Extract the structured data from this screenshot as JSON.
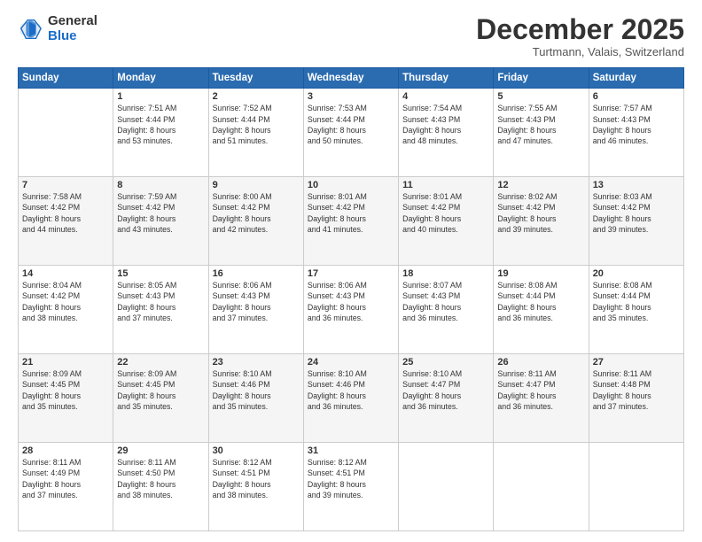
{
  "header": {
    "logo_general": "General",
    "logo_blue": "Blue",
    "month_title": "December 2025",
    "location": "Turtmann, Valais, Switzerland"
  },
  "days_of_week": [
    "Sunday",
    "Monday",
    "Tuesday",
    "Wednesday",
    "Thursday",
    "Friday",
    "Saturday"
  ],
  "weeks": [
    [
      {
        "day": "",
        "info": ""
      },
      {
        "day": "1",
        "info": "Sunrise: 7:51 AM\nSunset: 4:44 PM\nDaylight: 8 hours\nand 53 minutes."
      },
      {
        "day": "2",
        "info": "Sunrise: 7:52 AM\nSunset: 4:44 PM\nDaylight: 8 hours\nand 51 minutes."
      },
      {
        "day": "3",
        "info": "Sunrise: 7:53 AM\nSunset: 4:44 PM\nDaylight: 8 hours\nand 50 minutes."
      },
      {
        "day": "4",
        "info": "Sunrise: 7:54 AM\nSunset: 4:43 PM\nDaylight: 8 hours\nand 48 minutes."
      },
      {
        "day": "5",
        "info": "Sunrise: 7:55 AM\nSunset: 4:43 PM\nDaylight: 8 hours\nand 47 minutes."
      },
      {
        "day": "6",
        "info": "Sunrise: 7:57 AM\nSunset: 4:43 PM\nDaylight: 8 hours\nand 46 minutes."
      }
    ],
    [
      {
        "day": "7",
        "info": "Sunrise: 7:58 AM\nSunset: 4:42 PM\nDaylight: 8 hours\nand 44 minutes."
      },
      {
        "day": "8",
        "info": "Sunrise: 7:59 AM\nSunset: 4:42 PM\nDaylight: 8 hours\nand 43 minutes."
      },
      {
        "day": "9",
        "info": "Sunrise: 8:00 AM\nSunset: 4:42 PM\nDaylight: 8 hours\nand 42 minutes."
      },
      {
        "day": "10",
        "info": "Sunrise: 8:01 AM\nSunset: 4:42 PM\nDaylight: 8 hours\nand 41 minutes."
      },
      {
        "day": "11",
        "info": "Sunrise: 8:01 AM\nSunset: 4:42 PM\nDaylight: 8 hours\nand 40 minutes."
      },
      {
        "day": "12",
        "info": "Sunrise: 8:02 AM\nSunset: 4:42 PM\nDaylight: 8 hours\nand 39 minutes."
      },
      {
        "day": "13",
        "info": "Sunrise: 8:03 AM\nSunset: 4:42 PM\nDaylight: 8 hours\nand 39 minutes."
      }
    ],
    [
      {
        "day": "14",
        "info": "Sunrise: 8:04 AM\nSunset: 4:42 PM\nDaylight: 8 hours\nand 38 minutes."
      },
      {
        "day": "15",
        "info": "Sunrise: 8:05 AM\nSunset: 4:43 PM\nDaylight: 8 hours\nand 37 minutes."
      },
      {
        "day": "16",
        "info": "Sunrise: 8:06 AM\nSunset: 4:43 PM\nDaylight: 8 hours\nand 37 minutes."
      },
      {
        "day": "17",
        "info": "Sunrise: 8:06 AM\nSunset: 4:43 PM\nDaylight: 8 hours\nand 36 minutes."
      },
      {
        "day": "18",
        "info": "Sunrise: 8:07 AM\nSunset: 4:43 PM\nDaylight: 8 hours\nand 36 minutes."
      },
      {
        "day": "19",
        "info": "Sunrise: 8:08 AM\nSunset: 4:44 PM\nDaylight: 8 hours\nand 36 minutes."
      },
      {
        "day": "20",
        "info": "Sunrise: 8:08 AM\nSunset: 4:44 PM\nDaylight: 8 hours\nand 35 minutes."
      }
    ],
    [
      {
        "day": "21",
        "info": "Sunrise: 8:09 AM\nSunset: 4:45 PM\nDaylight: 8 hours\nand 35 minutes."
      },
      {
        "day": "22",
        "info": "Sunrise: 8:09 AM\nSunset: 4:45 PM\nDaylight: 8 hours\nand 35 minutes."
      },
      {
        "day": "23",
        "info": "Sunrise: 8:10 AM\nSunset: 4:46 PM\nDaylight: 8 hours\nand 35 minutes."
      },
      {
        "day": "24",
        "info": "Sunrise: 8:10 AM\nSunset: 4:46 PM\nDaylight: 8 hours\nand 36 minutes."
      },
      {
        "day": "25",
        "info": "Sunrise: 8:10 AM\nSunset: 4:47 PM\nDaylight: 8 hours\nand 36 minutes."
      },
      {
        "day": "26",
        "info": "Sunrise: 8:11 AM\nSunset: 4:47 PM\nDaylight: 8 hours\nand 36 minutes."
      },
      {
        "day": "27",
        "info": "Sunrise: 8:11 AM\nSunset: 4:48 PM\nDaylight: 8 hours\nand 37 minutes."
      }
    ],
    [
      {
        "day": "28",
        "info": "Sunrise: 8:11 AM\nSunset: 4:49 PM\nDaylight: 8 hours\nand 37 minutes."
      },
      {
        "day": "29",
        "info": "Sunrise: 8:11 AM\nSunset: 4:50 PM\nDaylight: 8 hours\nand 38 minutes."
      },
      {
        "day": "30",
        "info": "Sunrise: 8:12 AM\nSunset: 4:51 PM\nDaylight: 8 hours\nand 38 minutes."
      },
      {
        "day": "31",
        "info": "Sunrise: 8:12 AM\nSunset: 4:51 PM\nDaylight: 8 hours\nand 39 minutes."
      },
      {
        "day": "",
        "info": ""
      },
      {
        "day": "",
        "info": ""
      },
      {
        "day": "",
        "info": ""
      }
    ]
  ]
}
